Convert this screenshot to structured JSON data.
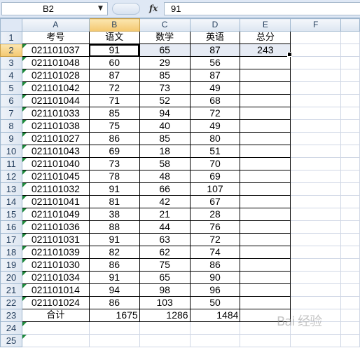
{
  "formula_bar": {
    "name_box": "B2",
    "fx_label": "fx",
    "formula_value": "91"
  },
  "columns": [
    "A",
    "B",
    "C",
    "D",
    "E",
    "F"
  ],
  "rows": [
    [
      "考号",
      "语文",
      "数学",
      "英语",
      "总分",
      ""
    ],
    [
      "021101037",
      "91",
      "65",
      "87",
      "243",
      ""
    ],
    [
      "021101048",
      "60",
      "29",
      "56",
      "",
      ""
    ],
    [
      "021101028",
      "87",
      "85",
      "87",
      "",
      ""
    ],
    [
      "021101042",
      "72",
      "73",
      "49",
      "",
      ""
    ],
    [
      "021101044",
      "71",
      "52",
      "68",
      "",
      ""
    ],
    [
      "021101033",
      "85",
      "94",
      "72",
      "",
      ""
    ],
    [
      "021101038",
      "75",
      "40",
      "49",
      "",
      ""
    ],
    [
      "021101027",
      "86",
      "85",
      "80",
      "",
      ""
    ],
    [
      "021101043",
      "69",
      "18",
      "51",
      "",
      ""
    ],
    [
      "021101040",
      "73",
      "58",
      "70",
      "",
      ""
    ],
    [
      "021101045",
      "78",
      "48",
      "69",
      "",
      ""
    ],
    [
      "021101032",
      "91",
      "66",
      "107",
      "",
      ""
    ],
    [
      "021101041",
      "81",
      "42",
      "67",
      "",
      ""
    ],
    [
      "021101049",
      "38",
      "21",
      "28",
      "",
      ""
    ],
    [
      "021101036",
      "88",
      "44",
      "76",
      "",
      ""
    ],
    [
      "021101031",
      "91",
      "63",
      "72",
      "",
      ""
    ],
    [
      "021101039",
      "82",
      "62",
      "74",
      "",
      ""
    ],
    [
      "021101030",
      "86",
      "75",
      "86",
      "",
      ""
    ],
    [
      "021101034",
      "91",
      "65",
      "90",
      "",
      ""
    ],
    [
      "021101014",
      "94",
      "98",
      "96",
      "",
      ""
    ],
    [
      "021101024",
      "86",
      "103",
      "50",
      "",
      ""
    ],
    [
      "合计",
      "1675",
      "1286",
      "1484",
      "",
      ""
    ],
    [
      "",
      "",
      "",
      "",
      "",
      ""
    ],
    [
      "",
      "",
      "",
      "",
      "",
      ""
    ]
  ],
  "watermark": "Bai 经验"
}
